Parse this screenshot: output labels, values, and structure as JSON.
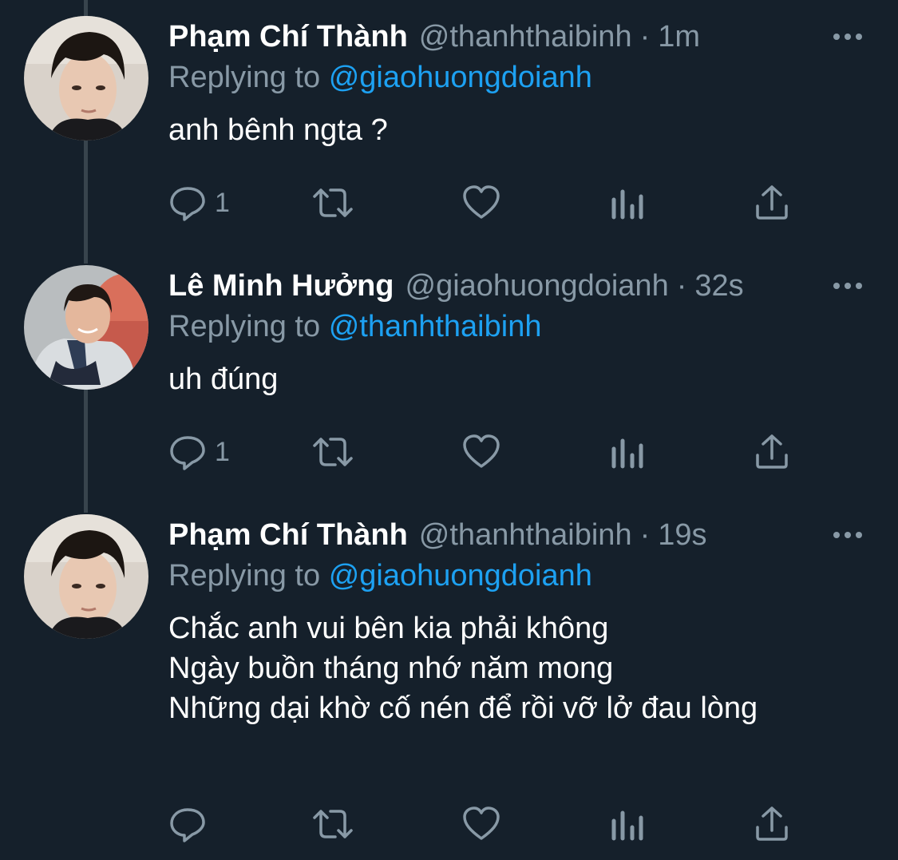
{
  "tweets": [
    {
      "name": "Phạm Chí Thành",
      "handle": "@thanhthaibinh",
      "time": "1m",
      "replying_prefix": "Replying to",
      "replying_to": "@giaohuongdoianh",
      "lines": [
        "anh bênh ngta ?"
      ],
      "reply_count": "1",
      "avatar": "avatar-dark-hair"
    },
    {
      "name": "Lê Minh Hưởng",
      "handle": "@giaohuongdoianh",
      "time": "32s",
      "replying_prefix": "Replying to",
      "replying_to": "@thanhthaibinh",
      "lines": [
        "uh đúng"
      ],
      "reply_count": "1",
      "avatar": "avatar-smiling"
    },
    {
      "name": "Phạm Chí Thành",
      "handle": "@thanhthaibinh",
      "time": "19s",
      "replying_prefix": "Replying to",
      "replying_to": "@giaohuongdoianh",
      "lines": [
        "Chắc anh vui bên kia phải không",
        "Ngày buồn tháng nhớ năm mong",
        "Những dại khờ cố nén để rồi vỡ lở đau lòng"
      ],
      "reply_count": "",
      "avatar": "avatar-dark-hair"
    }
  ],
  "icons": {
    "reply": "reply-icon",
    "retweet": "retweet-icon",
    "like": "heart-icon",
    "analytics": "analytics-icon",
    "share": "share-icon",
    "more": "more-icon"
  },
  "colors": {
    "background": "#15202b",
    "secondary_text": "#8899a6",
    "mention": "#1da1f2",
    "thread_line": "#38444d"
  },
  "separator": "·"
}
